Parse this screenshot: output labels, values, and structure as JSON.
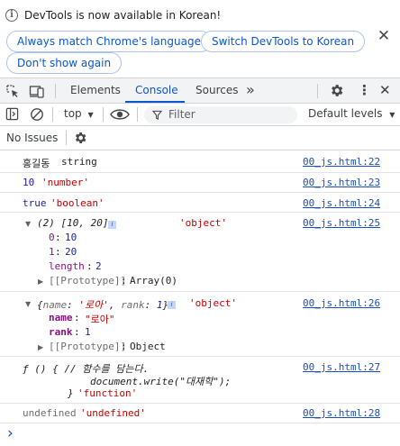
{
  "infobar": {
    "message": "DevTools is now available in Korean!",
    "buttons": [
      "Always match Chrome's language",
      "Switch DevTools to Korean",
      "Don't show again"
    ],
    "close_glyph": "✕"
  },
  "tabs": {
    "items": [
      "Elements",
      "Console",
      "Sources"
    ],
    "active": "Console",
    "more_glyph": "»",
    "menu_glyph": "⋮",
    "close_glyph": "✕"
  },
  "toolbar": {
    "context": "top",
    "filter_placeholder": "Filter",
    "levels": "Default levels"
  },
  "issues": {
    "label": "No Issues"
  },
  "console": {
    "rows": [
      {
        "text_a": "홍길동",
        "text_b": "string",
        "source": "00_js.html:22"
      },
      {
        "text_a": "10",
        "text_b": "'number'",
        "source": "00_js.html:23"
      },
      {
        "text_a": "true",
        "text_b": "'boolean'",
        "source": "00_js.html:24"
      }
    ],
    "array_row": {
      "summary": "(2) [10, 20]",
      "type": "'object'",
      "source": "00_js.html:25",
      "entries": [
        {
          "key": "0",
          "value": "10"
        },
        {
          "key": "1",
          "value": "20"
        },
        {
          "key": "length",
          "value": "2"
        }
      ],
      "prototype_key": "[[Prototype]]",
      "prototype_value": "Array(0)"
    },
    "object_row": {
      "summary_open": "{",
      "k1": "name",
      "v1": "'로아'",
      "k2": "rank",
      "v2": "1",
      "summary_close": "}",
      "type": "'object'",
      "source": "00_js.html:26",
      "entries": [
        {
          "key": "name",
          "value": "\"로아\""
        },
        {
          "key": "rank",
          "value": "1"
        }
      ],
      "prototype_key": "[[Prototype]]",
      "prototype_value": "Object"
    },
    "function_row": {
      "line1": "ƒ () { // 함수를 담는다.",
      "line2": "document.write(\"대재학\");",
      "line3": "}",
      "type": "'function'",
      "source": "00_js.html:27"
    },
    "undefined_row": {
      "text_a": "undefined",
      "text_b": "'undefined'",
      "source": "00_js.html:28"
    },
    "prompt_glyph": "›"
  }
}
